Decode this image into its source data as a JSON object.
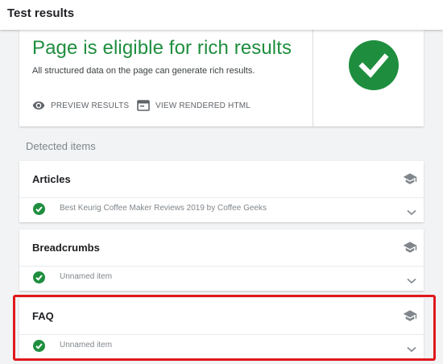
{
  "header": {
    "title": "Test results"
  },
  "summary": {
    "headline": "Page is eligible for rich results",
    "subline": "All structured data on the page can generate rich results.",
    "preview_label": "PREVIEW RESULTS",
    "render_label": "VIEW RENDERED HTML",
    "status_icon": "check-circle-icon",
    "status_color": "#1e8e3e"
  },
  "detected": {
    "label": "Detected items",
    "items": [
      {
        "title": "Articles",
        "row_text": "Best Keurig Coffee Maker Reviews 2019 by Coffee Geeks"
      },
      {
        "title": "Breadcrumbs",
        "row_text": "Unnamed item"
      },
      {
        "title": "FAQ",
        "row_text": "Unnamed item",
        "highlighted": true
      }
    ]
  },
  "colors": {
    "accent_green": "#1e8e3e",
    "highlight_red": "#e0181c",
    "icon_grey": "#80868b"
  }
}
